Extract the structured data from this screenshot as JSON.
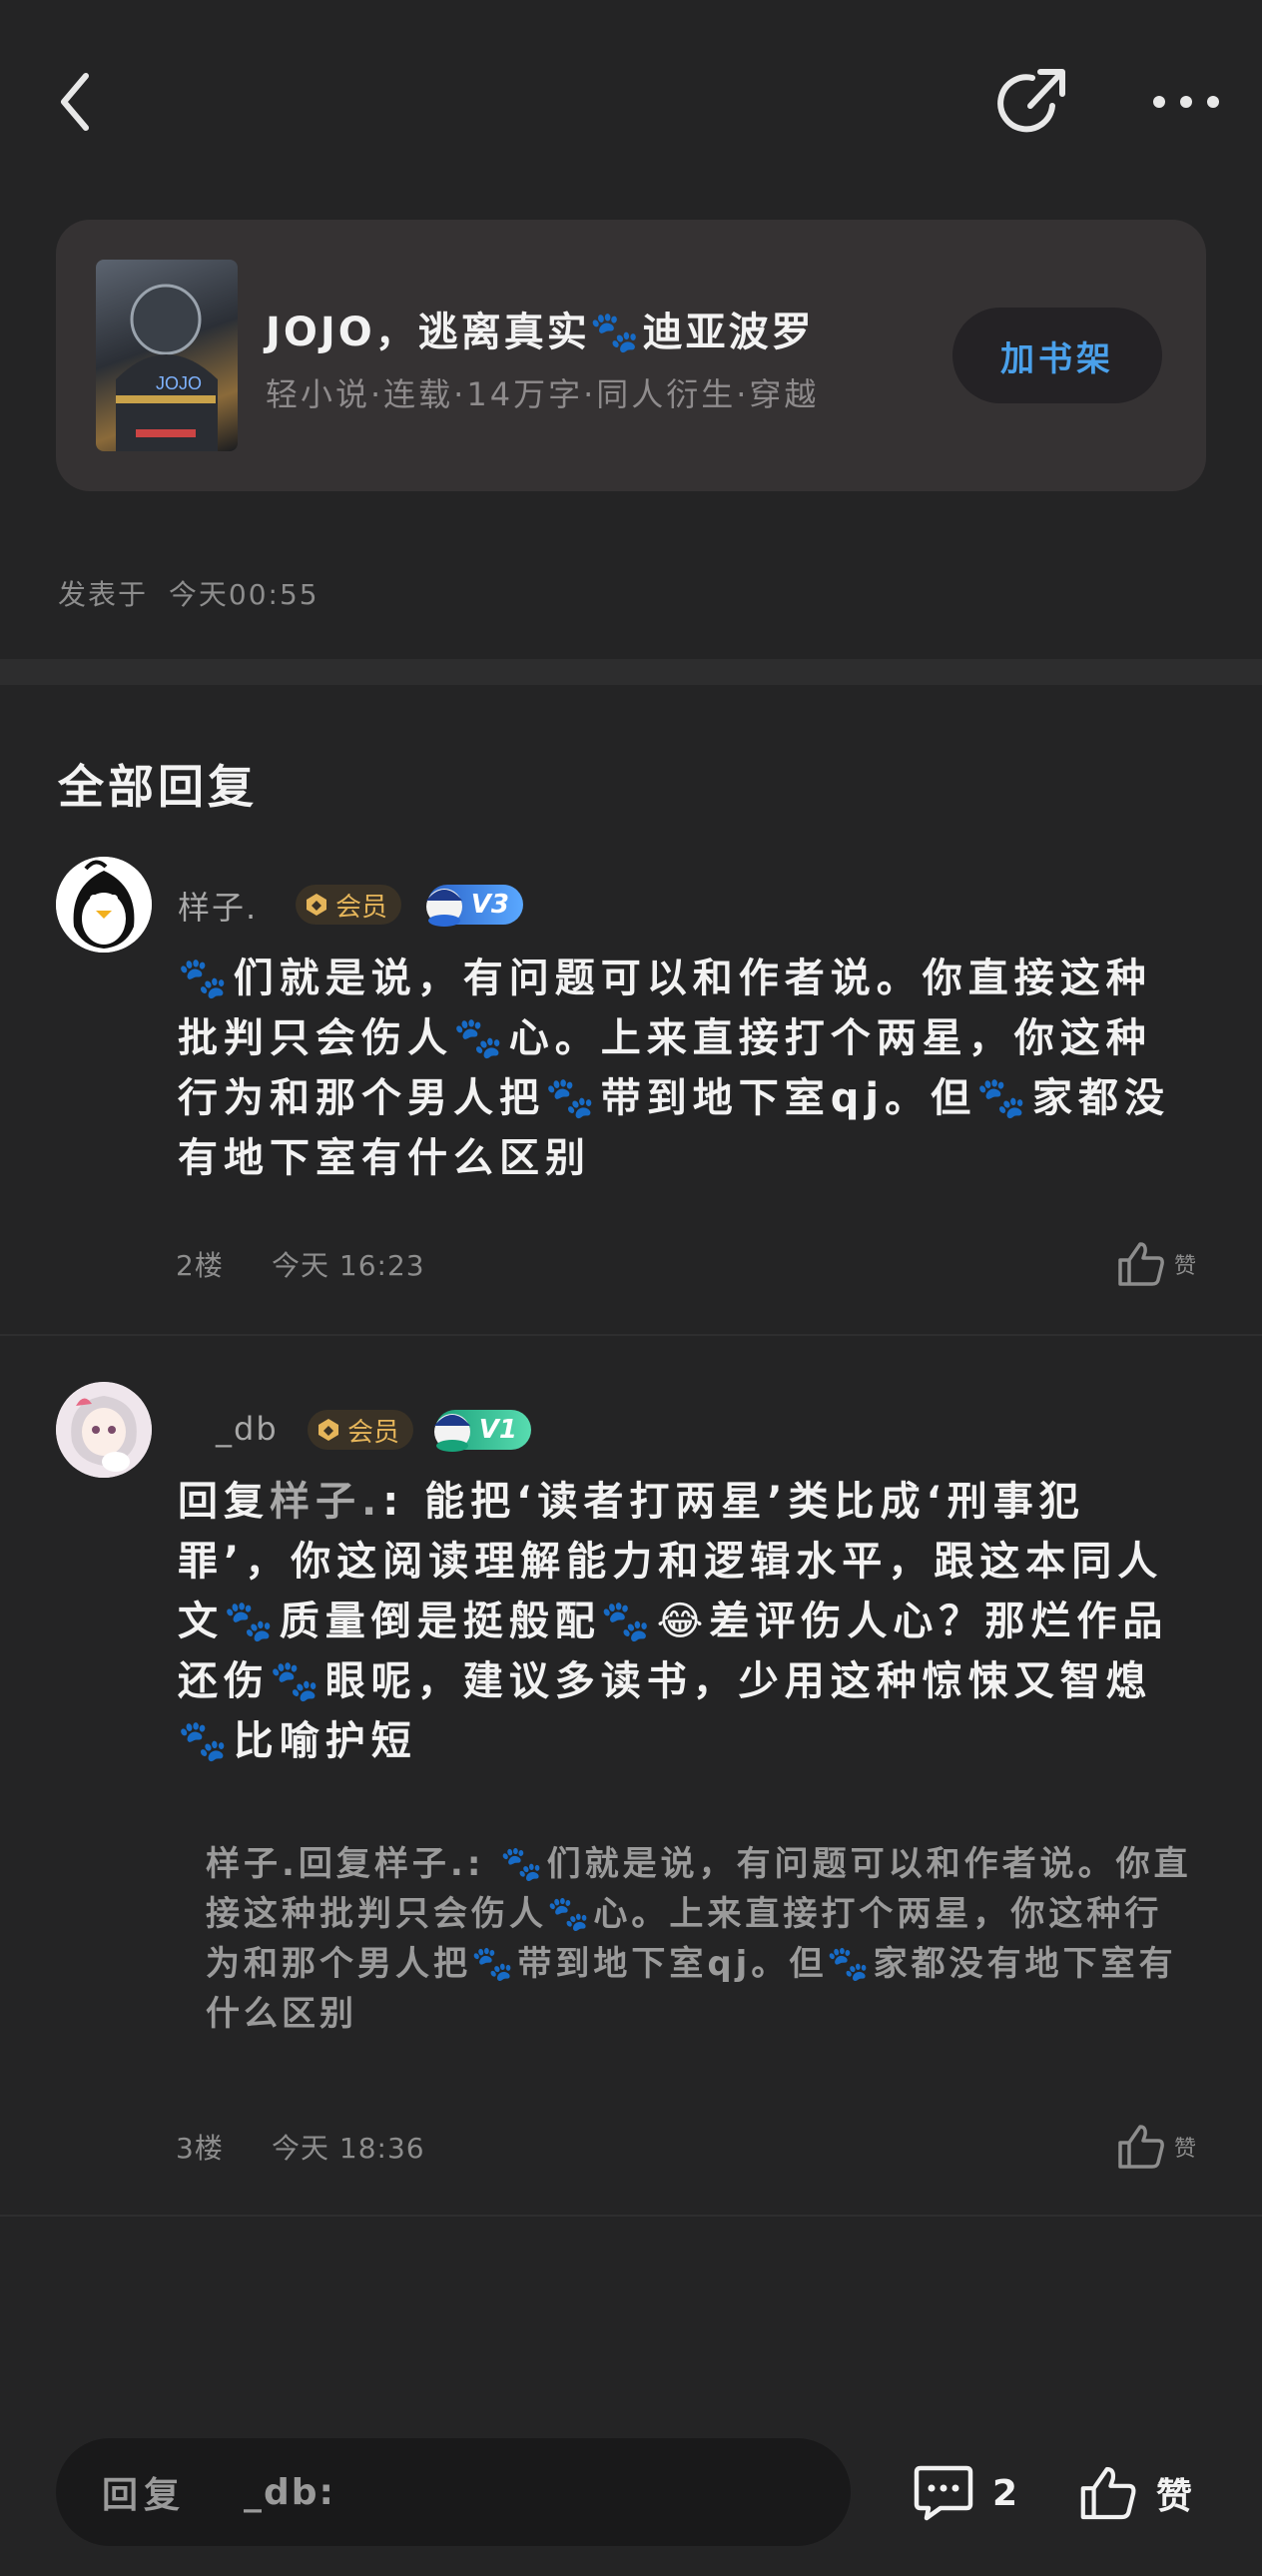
{
  "header": {
    "back_icon": "chevron-left-icon",
    "share_icon": "share-icon",
    "more_icon": "more-icon"
  },
  "book": {
    "title": "JOJO，逃离真实🐾迪亚波罗",
    "meta": "轻小说·连载·14万字·同人衍生·穿越",
    "add_shelf_label": "加书架"
  },
  "post": {
    "posted_label": "发表于",
    "posted_time": "今天00:55"
  },
  "replies_section": {
    "title": "全部回复"
  },
  "comments": [
    {
      "username": "样子.",
      "member_label": "会员",
      "level": "V3",
      "text": "🐾们就是说，有问题可以和作者说。你直接这种批判只会伤人🐾心。上来直接打个两星，你这种行为和那个男人把🐾带到地下室qj。但🐾家都没有地下室有什么区别",
      "floor": "2楼",
      "time": "今天 16:23",
      "like_label": "赞"
    },
    {
      "username": "_db",
      "member_label": "会员",
      "level": "V1",
      "reply_prefix": "回复",
      "reply_to": "样子.",
      "text": ": 能把‘读者打两星’类比成‘刑事犯罪’，你这阅读理解能力和逻辑水平，跟这本同人文🐾质量倒是挺般配🐾😂差评伤人心？那烂作品还伤🐾眼呢，建议多读书，少用这种惊悚又智熄🐾比喻护短",
      "quote": "样子.回复样子.: 🐾们就是说，有问题可以和作者说。你直接这种批判只会伤人🐾心。上来直接打个两星，你这种行为和那个男人把🐾带到地下室qj。但🐾家都没有地下室有什么区别",
      "floor": "3楼",
      "time": "今天 18:36",
      "like_label": "赞"
    }
  ],
  "bottom": {
    "reply_label": "回复",
    "reply_target": "_db:",
    "comment_count": "2",
    "like_label": "赞"
  },
  "colors": {
    "background": "#242425",
    "card": "#353233",
    "accent_blue": "#4aa0ea",
    "member_gold": "#e5b55a"
  }
}
